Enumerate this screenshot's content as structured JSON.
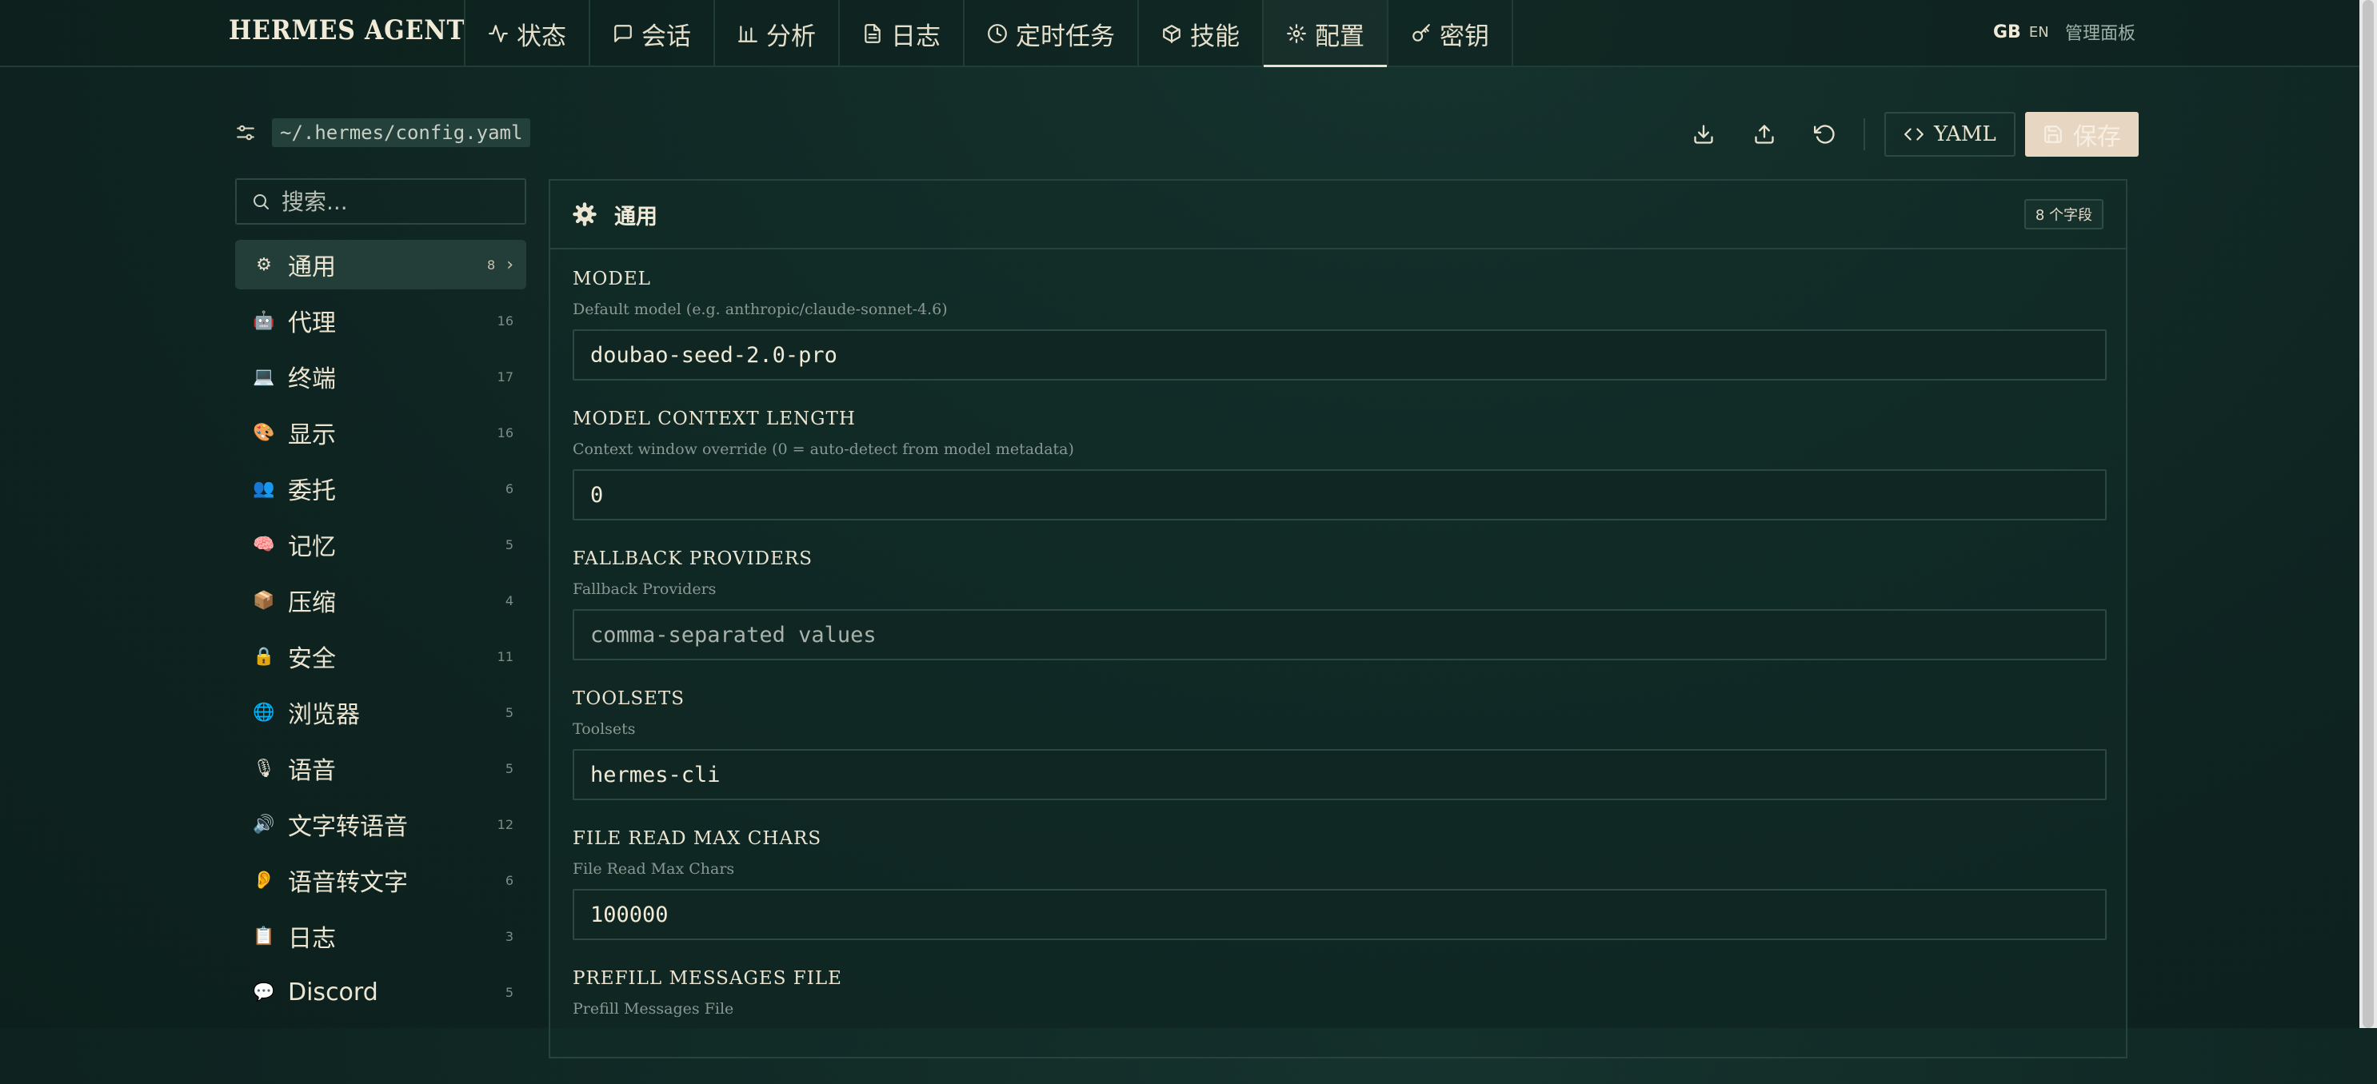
{
  "app": {
    "brand": "HERMES AGENT",
    "lang_primary": "GB",
    "lang_secondary": "EN",
    "admin_label": "管理面板"
  },
  "nav": [
    {
      "label": "状态",
      "icon": "activity-icon"
    },
    {
      "label": "会话",
      "icon": "chat-icon"
    },
    {
      "label": "分析",
      "icon": "bar-chart-icon"
    },
    {
      "label": "日志",
      "icon": "file-text-icon"
    },
    {
      "label": "定时任务",
      "icon": "clock-icon"
    },
    {
      "label": "技能",
      "icon": "package-icon"
    },
    {
      "label": "配置",
      "icon": "gear-icon",
      "active": true
    },
    {
      "label": "密钥",
      "icon": "key-icon"
    }
  ],
  "toolbar": {
    "config_path": "~/.hermes/config.yaml",
    "yaml_label": "YAML",
    "save_label": "保存"
  },
  "sidebar": {
    "search_placeholder": "搜索...",
    "categories": [
      {
        "label": "通用",
        "count": "8",
        "icon": "⚙",
        "active": true
      },
      {
        "label": "代理",
        "count": "16",
        "icon": "🤖"
      },
      {
        "label": "终端",
        "count": "17",
        "icon": "💻"
      },
      {
        "label": "显示",
        "count": "16",
        "icon": "🎨"
      },
      {
        "label": "委托",
        "count": "6",
        "icon": "👥"
      },
      {
        "label": "记忆",
        "count": "5",
        "icon": "🧠"
      },
      {
        "label": "压缩",
        "count": "4",
        "icon": "📦"
      },
      {
        "label": "安全",
        "count": "11",
        "icon": "🔒"
      },
      {
        "label": "浏览器",
        "count": "5",
        "icon": "🌐"
      },
      {
        "label": "语音",
        "count": "5",
        "icon": "🎙"
      },
      {
        "label": "文字转语音",
        "count": "12",
        "icon": "🔊"
      },
      {
        "label": "语音转文字",
        "count": "6",
        "icon": "👂"
      },
      {
        "label": "日志",
        "count": "3",
        "icon": "📋"
      },
      {
        "label": "Discord",
        "count": "5",
        "icon": "💬"
      }
    ]
  },
  "panel": {
    "title": "通用",
    "field_count_label": "8 个字段",
    "fields": [
      {
        "label": "MODEL",
        "desc": "Default model (e.g. anthropic/claude-sonnet-4.6)",
        "value": "doubao-seed-2.0-pro",
        "placeholder": ""
      },
      {
        "label": "MODEL CONTEXT LENGTH",
        "desc": "Context window override (0 = auto-detect from model metadata)",
        "value": "0",
        "placeholder": ""
      },
      {
        "label": "FALLBACK PROVIDERS",
        "desc": "Fallback Providers",
        "value": "",
        "placeholder": "comma-separated values"
      },
      {
        "label": "TOOLSETS",
        "desc": "Toolsets",
        "value": "hermes-cli",
        "placeholder": ""
      },
      {
        "label": "FILE READ MAX CHARS",
        "desc": "File Read Max Chars",
        "value": "100000",
        "placeholder": ""
      },
      {
        "label": "PREFILL MESSAGES FILE",
        "desc": "Prefill Messages File",
        "value": "",
        "placeholder": ""
      }
    ]
  },
  "colors": {
    "background": "#0f2724",
    "text": "#e9e2cf",
    "border": "#26433e",
    "save_button": "#e7d7c2"
  }
}
